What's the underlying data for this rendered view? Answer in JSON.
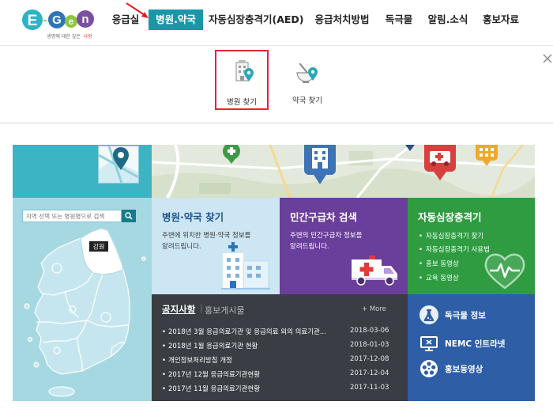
{
  "logo": {
    "name": "E-Gen",
    "tagline": "생명에 대한 깊은",
    "tagline_accent": "사랑"
  },
  "nav": {
    "items": [
      {
        "label": "응급실"
      },
      {
        "label": "병원.약국",
        "active": true
      },
      {
        "label": "자동심장충격기(AED)"
      },
      {
        "label": "응급처치방법"
      },
      {
        "label": "독극물"
      },
      {
        "label": "알림.소식"
      },
      {
        "label": "홍보자료"
      }
    ]
  },
  "submenu": {
    "items": [
      {
        "label": "병원 찾기",
        "icon": "hospital-pin-icon",
        "highlighted": true
      },
      {
        "label": "약국 찾기",
        "icon": "pharmacy-pin-icon"
      }
    ],
    "close_icon": "close-icon"
  },
  "region_search": {
    "placeholder": "지역 선택 또는 병원명으로 검색",
    "button_icon": "search-icon",
    "map_icon": "map-pin-icon",
    "selected_region": "강원"
  },
  "cards": [
    {
      "title": "병원·약국 찾기",
      "desc": [
        "주변에 위치한 병원·약국 정보를",
        "알려드립니다."
      ],
      "icon": "hospital-building-icon"
    },
    {
      "title": "민간구급차 검색",
      "desc": [
        "주변의 민간구급차 정보를",
        "알려드립니다."
      ],
      "icon": "ambulance-icon"
    },
    {
      "title": "자동심장충격기",
      "links": [
        "자동심장충격기 찾기",
        "자동심장충격기 사용법",
        "홍보 동영상",
        "교육 동영상"
      ],
      "icon": "heart-pulse-icon"
    }
  ],
  "notice": {
    "tabs": [
      {
        "label": "공지사항",
        "active": true
      },
      {
        "label": "홍보게시물"
      }
    ],
    "divider": "|",
    "more": "+ More",
    "items": [
      {
        "title": "2018년 3월 응급의료기관 및 응급의료 외의 의료기관...",
        "date": "2018-03-06"
      },
      {
        "title": "2018년 1월 응급의료기관 현황",
        "date": "2018-01-03"
      },
      {
        "title": "개인정보처리방침 개정",
        "date": "2017-12-08"
      },
      {
        "title": "2017년 12월 응급의료기관현황",
        "date": "2017-12-04"
      },
      {
        "title": "2017년 11월 응급의료기관현황",
        "date": "2017-11-03"
      }
    ]
  },
  "quick_links": [
    {
      "label": "독극물 정보",
      "icon": "poison-flask-icon"
    },
    {
      "label": "NEMC 인트라넷",
      "icon": "intranet-monitor-icon"
    },
    {
      "label": "홍보동영상",
      "icon": "video-reel-icon"
    }
  ],
  "colors": {
    "nav_active": "#1a97a7",
    "highlight_box": "#e4252b",
    "region_teal": "#3cb4c3",
    "region_panel": "#a6d8e2",
    "card_hospital": "#cde6f4",
    "card_ambulance": "#6a3e9b",
    "card_aed": "#2f9c41",
    "notice_bg": "#3a3d43",
    "quick_links_bg": "#2e5ea6"
  }
}
